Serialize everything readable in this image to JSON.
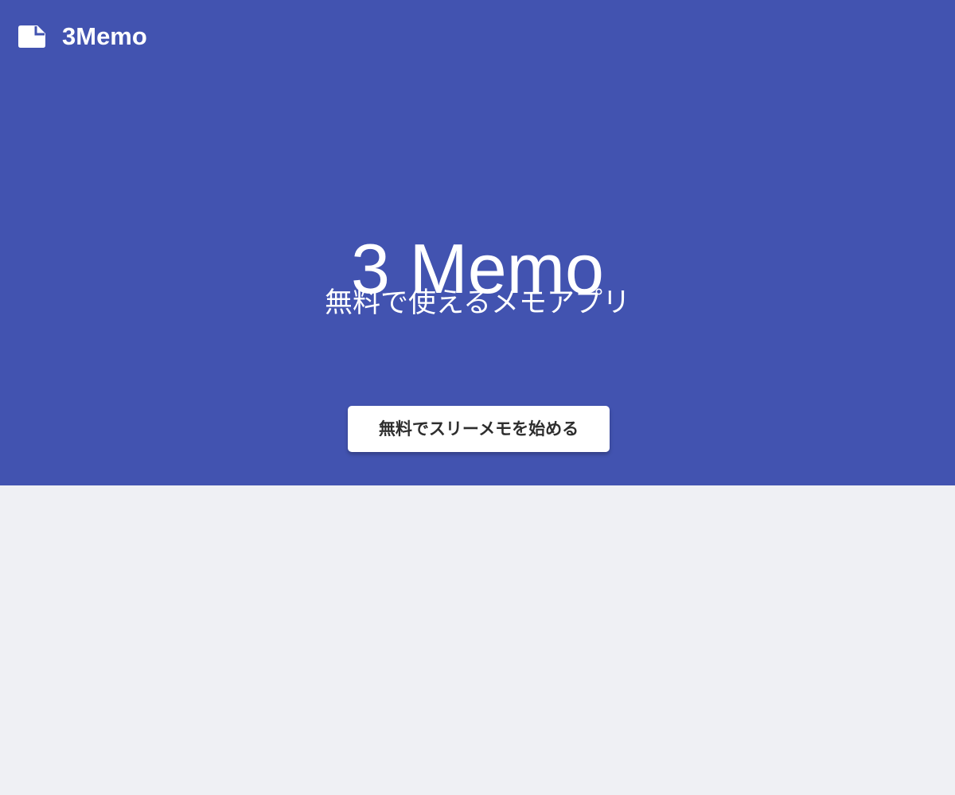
{
  "header": {
    "brand": {
      "icon": "memo-icon",
      "name": "3Memo"
    }
  },
  "hero": {
    "title": "3 Memo",
    "subtitle": "無料で使えるメモアプリ",
    "cta_label": "無料でスリーメモを始める"
  },
  "colors": {
    "hero_background": "#4253b0",
    "page_background": "#eff0f4",
    "hero_text": "#ffffff",
    "button_background": "#ffffff",
    "button_text": "#2e2e2e"
  }
}
